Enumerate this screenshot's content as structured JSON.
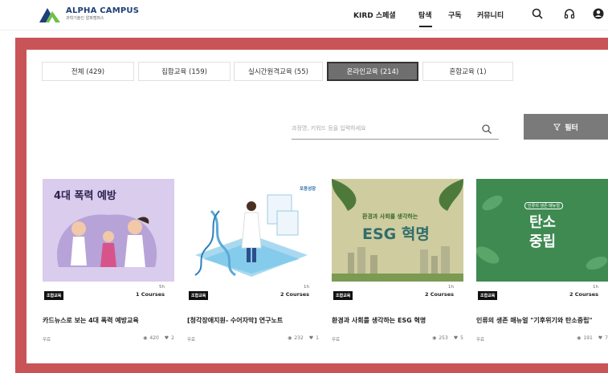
{
  "header": {
    "logo_title": "ALPHA CAMPUS",
    "logo_subtitle": "과학기술인 알파캠퍼스",
    "nav": [
      "KIRD 스페셜",
      "탐색",
      "구독",
      "커뮤니티"
    ],
    "active_nav": "탐색",
    "colors": {
      "logo_blue": "#1e3f77",
      "logo_green": "#6cc04a"
    }
  },
  "tabs": [
    {
      "label": "전체 (429)",
      "active": false
    },
    {
      "label": "집합교육 (159)",
      "active": false
    },
    {
      "label": "실시간원격교육 (55)",
      "active": false
    },
    {
      "label": "온라인교육 (214)",
      "active": true
    },
    {
      "label": "혼합교육 (1)",
      "active": false
    }
  ],
  "search": {
    "placeholder": "과정명, 키워드 등을 입력하세요"
  },
  "filter": {
    "label": "필터",
    "icon": "funnel-icon"
  },
  "cards": [
    {
      "thumb_text": "4대 폭력 예방",
      "badge": "조합교육",
      "duration": "5h",
      "courses": "1 Courses",
      "title": "카드뉴스로 보는 4대 폭력 예방교육",
      "price": "무료",
      "views": "420",
      "likes": "2"
    },
    {
      "thumb_text": "포용성장",
      "badge": "조합교육",
      "duration": "1h",
      "courses": "2 Courses",
      "title": "[청각장애지원- 수어자막] 연구노트",
      "price": "무료",
      "views": "232",
      "likes": "1"
    },
    {
      "thumb_text": "ESG 혁명",
      "thumb_subtext": "환경과 사회를 생각하는",
      "badge": "조합교육",
      "duration": "1h",
      "courses": "2 Courses",
      "title": "환경과 사회를 생각하는 ESG 혁명",
      "price": "무료",
      "views": "253",
      "likes": "5"
    },
    {
      "thumb_text_1": "탄소",
      "thumb_text_2": "중립",
      "thumb_tag": "인류의 생존 매뉴얼",
      "badge": "조합교육",
      "duration": "1h",
      "courses": "2 Courses",
      "title": "인류의 생존 매뉴얼 \"기후위기와 탄소중립\"",
      "price": "무료",
      "views": "191",
      "likes": "7"
    }
  ]
}
